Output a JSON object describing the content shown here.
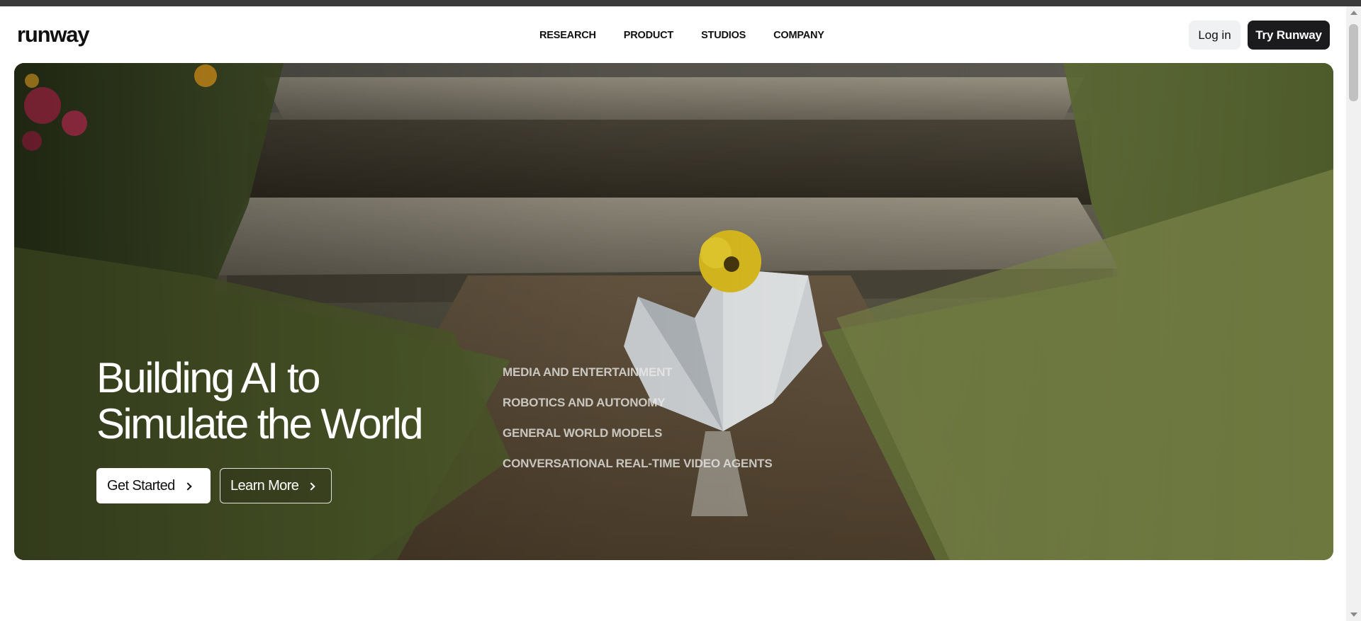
{
  "header": {
    "logo": "runway",
    "nav": [
      "RESEARCH",
      "PRODUCT",
      "STUDIOS",
      "COMPANY"
    ],
    "login_label": "Log in",
    "try_label": "Try Runway"
  },
  "hero": {
    "headline_line1": "Building AI to",
    "headline_line2": "Simulate the World",
    "primary_cta": "Get Started",
    "secondary_cta": "Learn More",
    "categories": [
      "MEDIA AND ENTERTAINMENT",
      "ROBOTICS AND AUTONOMY",
      "GENERAL WORLD MODELS",
      "CONVERSATIONAL REAL-TIME VIDEO AGENTS"
    ]
  }
}
